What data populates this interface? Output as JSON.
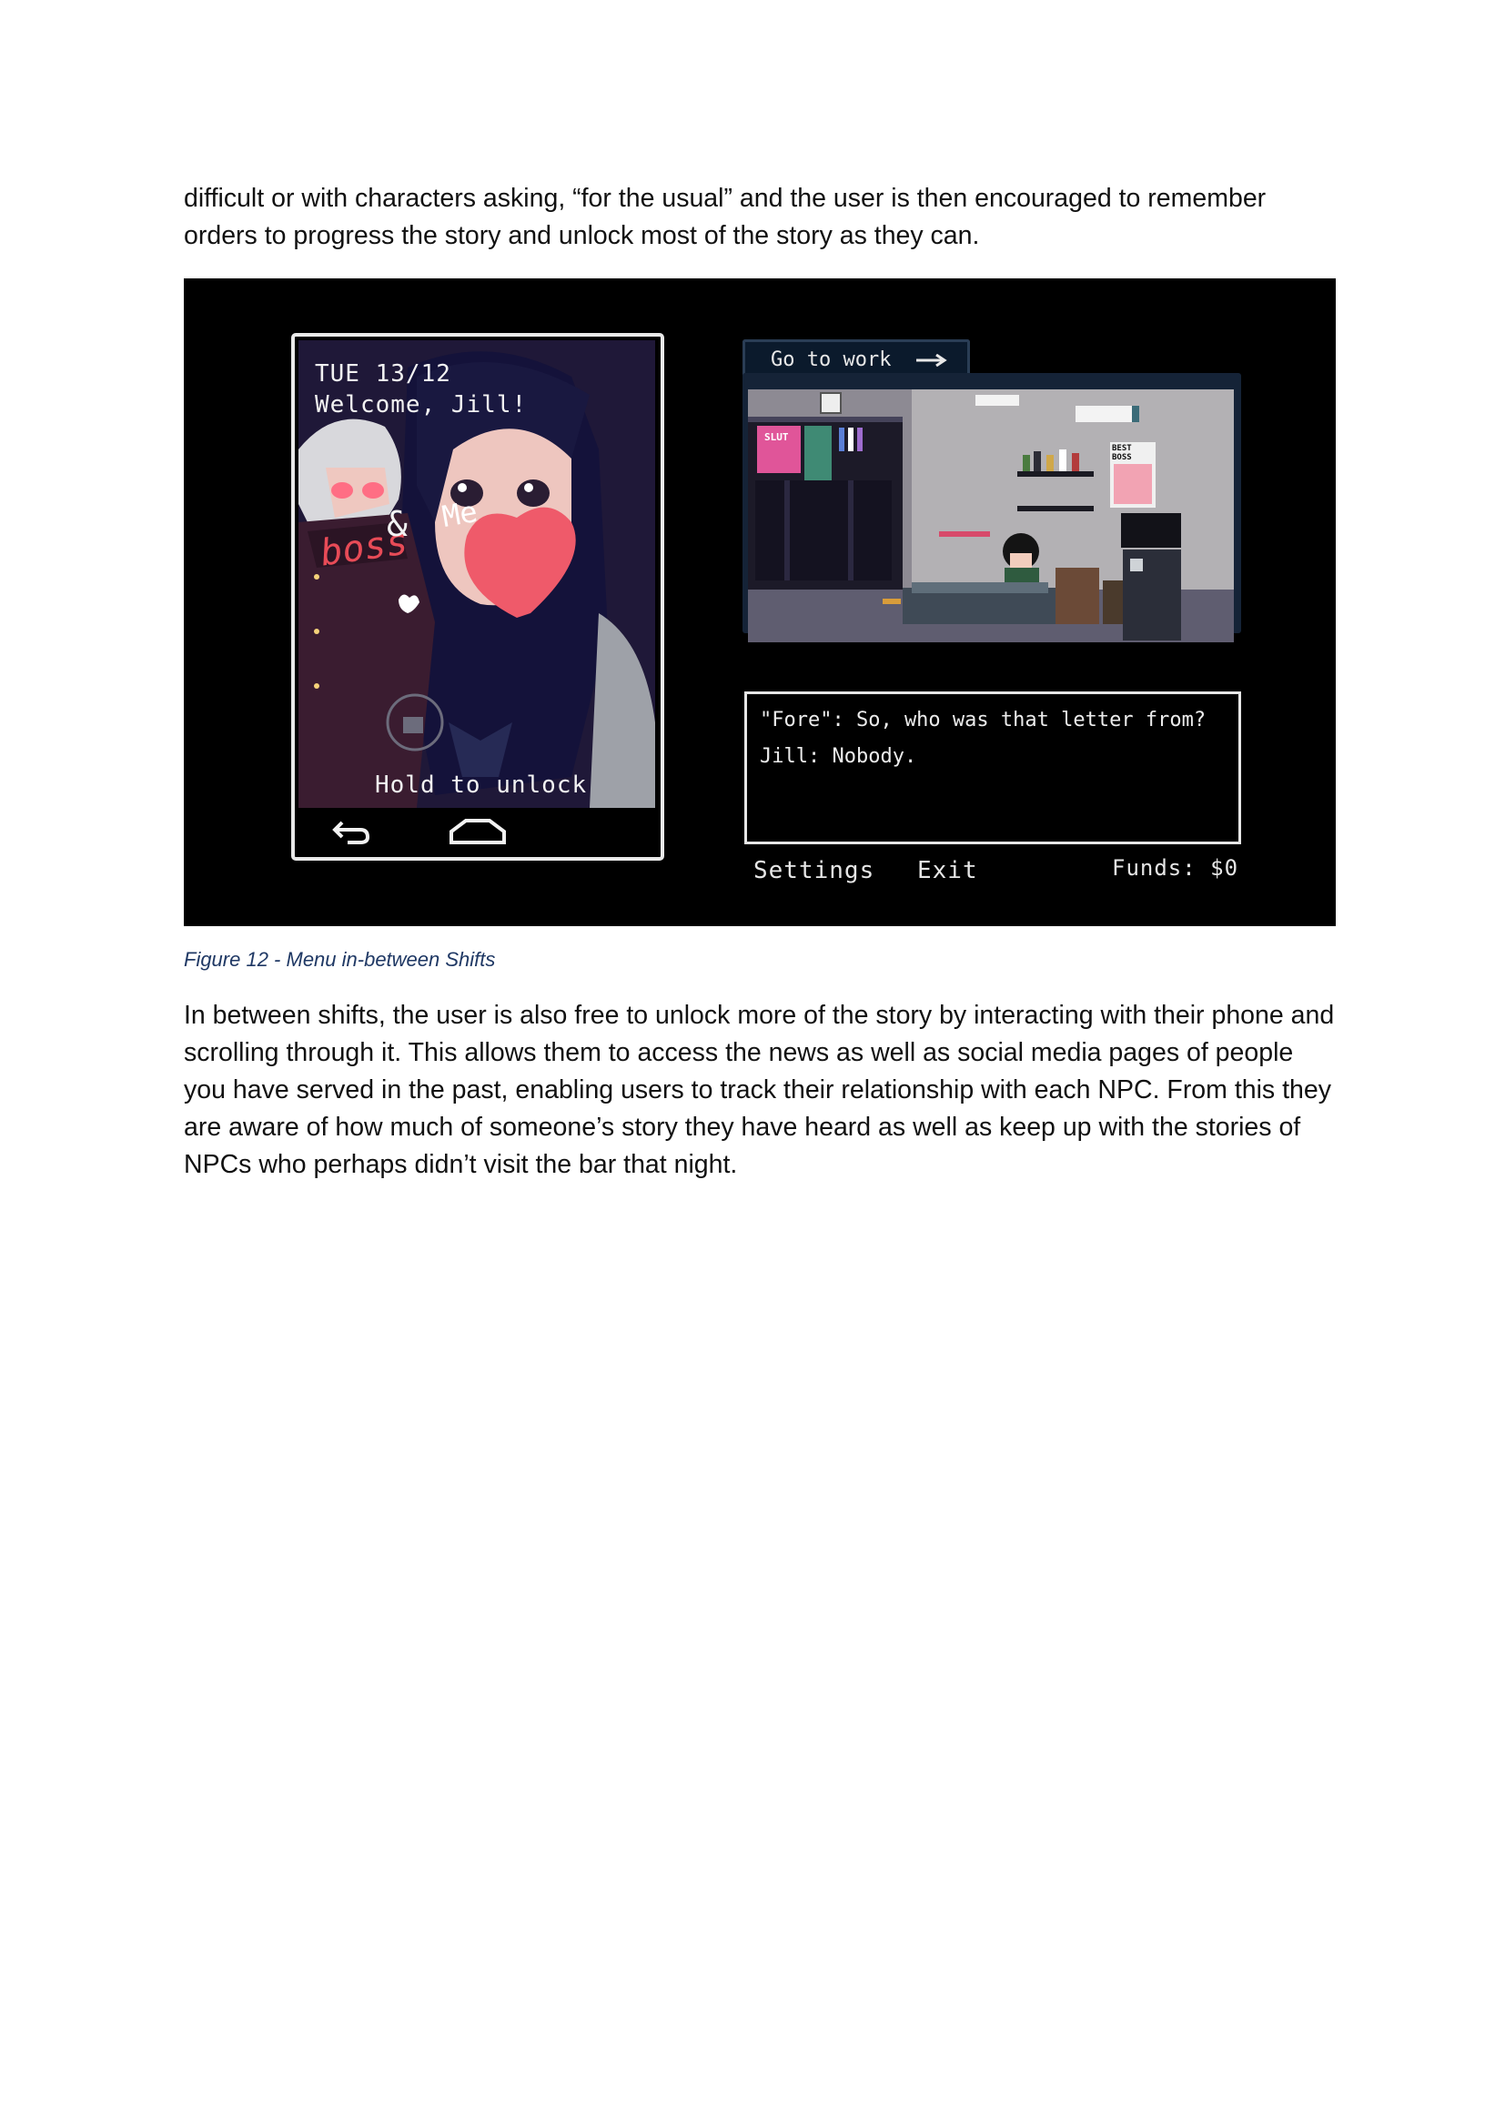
{
  "paragraphs": {
    "p1": "difficult or with characters asking, “for the usual” and the user is then encouraged to remember orders to progress the story and unlock most of the story as they can.",
    "p2": "In between shifts, the user is also free to unlock more of the story by interacting with their phone and scrolling through it. This allows them to access the news as well as social media pages of people you have served in the past, enabling users to track their relationship with each NPC. From this they are aware of how much of someone’s story they have heard as well as keep up with the stories of NPCs who perhaps didn’t visit the bar that night."
  },
  "caption": "Figure 12 - Menu in-between Shifts",
  "game": {
    "phone": {
      "date": "TUE 13/12",
      "welcome": "Welcome, Jill!",
      "wallpaper_text": [
        "boss",
        "&",
        "Me"
      ],
      "hint": "Hold to unlock",
      "nav_icons": [
        "back-arrow-icon",
        "home-icon"
      ]
    },
    "tab_label": "Go to work",
    "tab_icon": "arrow-right-icon",
    "room_signs": [
      "SLUT",
      "BEST BOSS"
    ],
    "dialog": {
      "line1": "\"Fore\": So, who was that letter from?",
      "line2": "Jill: Nobody."
    },
    "menu": {
      "settings": "Settings",
      "exit": "Exit",
      "funds": "Funds: $0"
    }
  }
}
